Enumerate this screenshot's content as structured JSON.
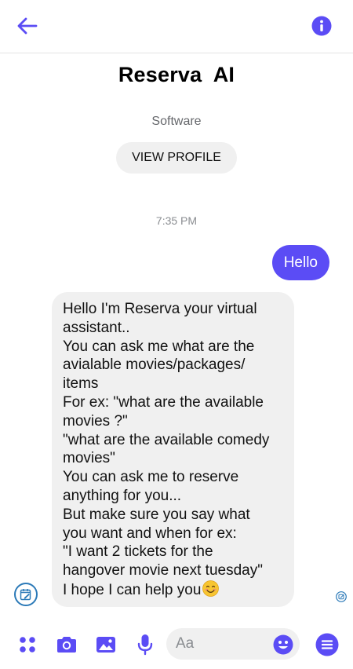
{
  "header": {
    "back_icon": "arrow-left-icon",
    "info_icon": "info-icon",
    "accent_color": "#5b4cf5"
  },
  "profile": {
    "name": "Reserva  AI",
    "category": "Software",
    "view_profile_label": "VIEW PROFILE"
  },
  "conversation": {
    "timestamp": "7:35 PM",
    "outgoing_message": "Hello",
    "incoming_message_lines": [
      "Hello I'm Reserva your virtual",
      "assistant..",
      "You can ask me what are the",
      "avialable movies/packages/",
      "items",
      "For ex: \"what are the available",
      "movies ?\"",
      "\"what are the available comedy",
      "movies\"",
      "You can ask me to reserve",
      "anything for you...",
      "But make sure you say what",
      "you want and when for ex:",
      "\"I want 2 tickets for the",
      "hangover movie next tuesday\"",
      "I hope I can help you"
    ],
    "incoming_emoji": "smiling-face-icon"
  },
  "composer": {
    "placeholder": "Aa",
    "value": "",
    "buttons": [
      "apps-grid-icon",
      "camera-icon",
      "image-icon",
      "microphone-icon",
      "emoji-icon",
      "menu-icon"
    ]
  }
}
